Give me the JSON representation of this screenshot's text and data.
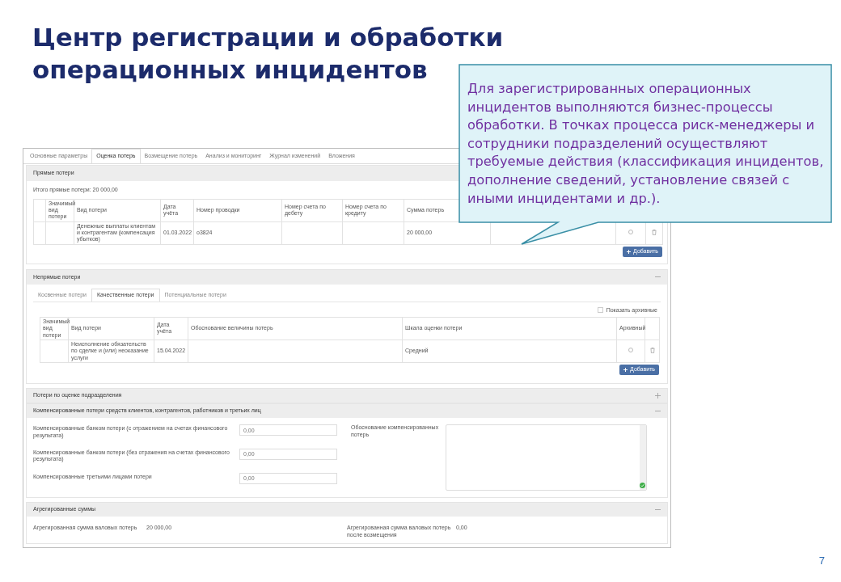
{
  "title_lines": [
    "Центр регистрации и обработки",
    "операционных инцидентов"
  ],
  "callout": "Для зарегистрированных операционных инцидентов выполняются бизнес-процессы обработки. В точках процесса риск-менеджеры и сотрудники подразделений осуществляют требуемые действия (классификация инцидентов, дополнение сведений, установление связей с иными инцидентами и др.).",
  "page_number": "7",
  "tabs": [
    {
      "label": "Основные параметры",
      "selected": false
    },
    {
      "label": "Оценка потерь",
      "selected": true
    },
    {
      "label": "Возмещение потерь",
      "selected": false
    },
    {
      "label": "Анализ и мониторинг",
      "selected": false
    },
    {
      "label": "Журнал изменений",
      "selected": false
    },
    {
      "label": "Вложения",
      "selected": false
    }
  ],
  "direct": {
    "title": "Прямые потери",
    "total": "Итого прямые потери: 20 000,00",
    "columns": [
      "",
      "Значимый вид потери",
      "Вид потери",
      "Дата учёта",
      "Номер проводки",
      "Номер счета по дебету",
      "Номер счета по кредиту",
      "Сумма потерь"
    ],
    "rows": [
      {
        "cells": [
          "",
          "",
          "Денежные выплаты клиентам и контрагентам (компенсация убытков)",
          "01.03.2022",
          "о3824",
          "",
          "",
          "20 000,00"
        ],
        "archived": false
      }
    ],
    "add_button": "Добавить"
  },
  "indirect": {
    "title": "Непрямые потери",
    "expanded": true,
    "subtabs": [
      {
        "label": "Косвенные потери",
        "selected": false
      },
      {
        "label": "Качественные потери",
        "selected": true
      },
      {
        "label": "Потенциальные потери",
        "selected": false
      }
    ],
    "show_archived": {
      "label": "Показать архивные",
      "checked": false
    },
    "columns": [
      "Значимый вид потери",
      "Вид потери",
      "Дата учёта",
      "Обоснование величины потерь",
      "Шкала оценки потери",
      "Архивный"
    ],
    "rows": [
      {
        "cells": [
          "",
          "Неисполнение обязательств по сделке и (или) неоказание услуги",
          "15.04.2022",
          "",
          "Средний"
        ],
        "archived": false
      }
    ],
    "add_button": "Добавить"
  },
  "unit_losses": {
    "title": "Потери по оценке подразделения",
    "expanded": false
  },
  "compensated": {
    "title": "Компенсированные потери средств клиентов, контрагентов, работников и третьих лиц",
    "expanded": true,
    "fields": [
      {
        "label": "Компенсированные банком потери (с отражением на счетах финансового результата)",
        "value": "0,00"
      },
      {
        "label": "Компенсированные банком потери (без отражения на счетах финансового результата)",
        "value": "0,00"
      },
      {
        "label": "Компенсированные третьими лицами потери",
        "value": "0,00"
      }
    ],
    "justification_label": "Обоснование компенсированных потерь"
  },
  "aggregated": {
    "title": "Агрегированные суммы",
    "expanded": true,
    "items": [
      {
        "label": "Агрегированная сумма валовых потерь",
        "value": "20 000,00"
      },
      {
        "label": "Агрегированная сумма валовых потерь после возмещения",
        "value": "0,00"
      }
    ]
  }
}
